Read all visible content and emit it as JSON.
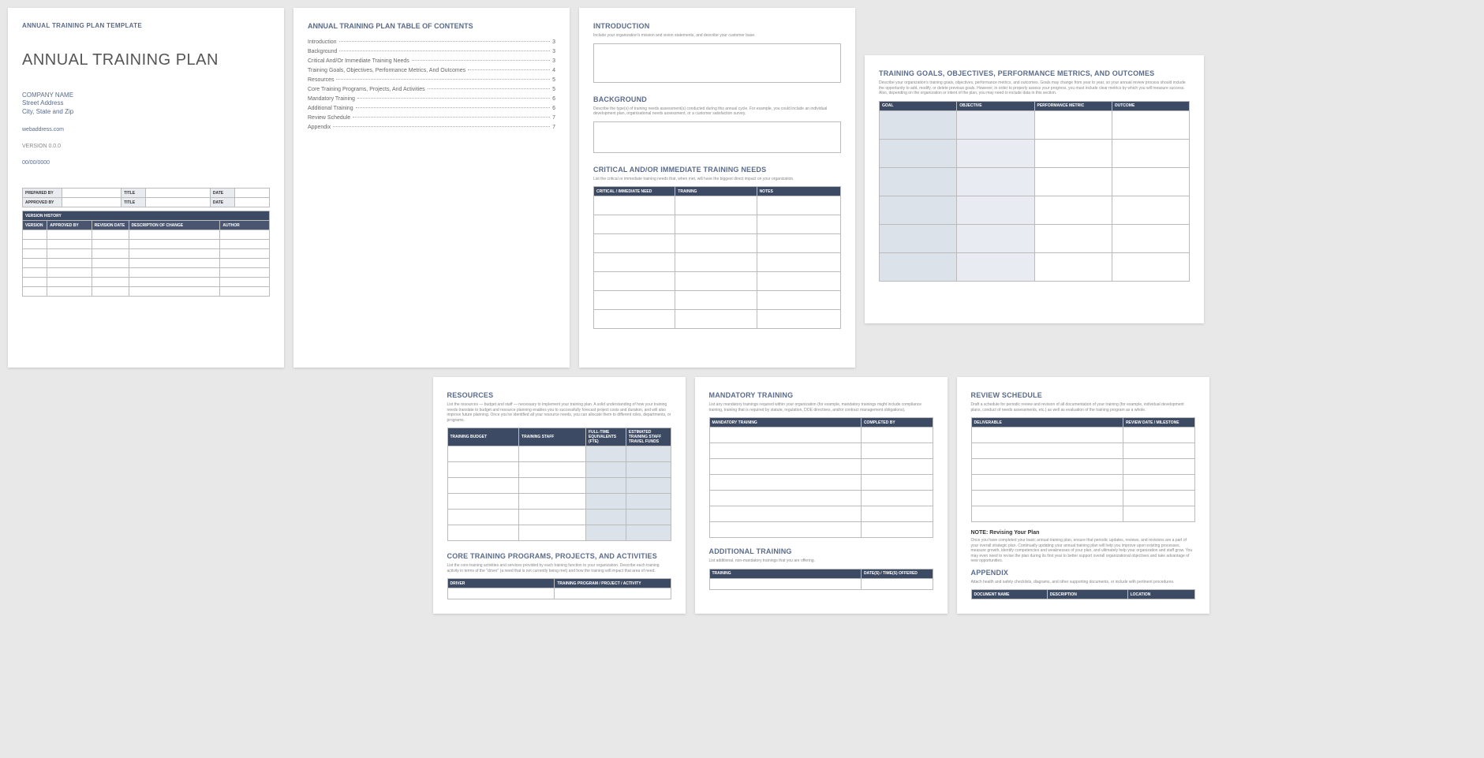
{
  "page1": {
    "header": "ANNUAL TRAINING PLAN TEMPLATE",
    "title": "ANNUAL TRAINING PLAN",
    "company": "COMPANY NAME",
    "street": "Street Address",
    "city": "City, State and Zip",
    "web": "webaddress.com",
    "version": "VERSION 0.0.0",
    "date": "00/00/0000",
    "prep_label": "PREPARED BY",
    "appr_label": "APPROVED BY",
    "title_label": "TITLE",
    "date_label": "DATE",
    "vh_header": "VERSION HISTORY",
    "vh_cols": {
      "c1": "VERSION",
      "c2": "APPROVED BY",
      "c3": "REVISION DATE",
      "c4": "DESCRIPTION OF CHANGE",
      "c5": "AUTHOR"
    }
  },
  "page2": {
    "title": "ANNUAL TRAINING PLAN TABLE OF CONTENTS",
    "items": [
      {
        "label": "Introduction",
        "pg": "3"
      },
      {
        "label": "Background",
        "pg": "3"
      },
      {
        "label": "Critical And/Or Immediate Training Needs",
        "pg": "3"
      },
      {
        "label": "Training Goals, Objectives, Performance Metrics, And Outcomes",
        "pg": "4"
      },
      {
        "label": "Resources",
        "pg": "5"
      },
      {
        "label": "Core Training Programs, Projects, And Activities",
        "pg": "5"
      },
      {
        "label": "Mandatory Training",
        "pg": "6"
      },
      {
        "label": "Additional Training",
        "pg": "6"
      },
      {
        "label": "Review Schedule",
        "pg": "7"
      },
      {
        "label": "Appendix",
        "pg": "7"
      }
    ]
  },
  "page3": {
    "intro_title": "INTRODUCTION",
    "intro_desc": "Include your organization's mission and vision statements, and describe your customer base.",
    "bg_title": "BACKGROUND",
    "bg_desc": "Describe the type(s) of training needs assessment(s) conducted during this annual cycle. For example, you could include an individual development plan, organizational needs assessment, or a customer satisfaction survey.",
    "crit_title": "CRITICAL AND/OR IMMEDIATE TRAINING NEEDS",
    "crit_desc": "List the critical or immediate training needs that, when met, will have the biggest direct impact on your organization.",
    "crit_cols": {
      "c1": "CRITICAL / IMMEDIATE NEED",
      "c2": "TRAINING",
      "c3": "NOTES"
    }
  },
  "page4": {
    "title": "TRAINING GOALS, OBJECTIVES, PERFORMANCE METRICS, AND OUTCOMES",
    "desc": "Describe your organization's training goals, objectives, performance metrics, and outcomes. Goals may change from year to year, so your annual review process should include the opportunity to add, modify, or delete previous goals. However, in order to properly assess your progress, you must include clear metrics by which you will measure success. Also, depending on the organization or intent of the plan, you may need to include data in this section.",
    "cols": {
      "c1": "GOAL",
      "c2": "OBJECTIVE",
      "c3": "PERFORMANCE METRIC",
      "c4": "OUTCOME"
    }
  },
  "page5": {
    "res_title": "RESOURCES",
    "res_desc": "List the resources — budget and staff — necessary to implement your training plan. A solid understanding of how your training needs translate to budget and resource planning enables you to successfully forecast project costs and duration, and will also improve future planning. Once you've identified all your resource needs, you can allocate them to different roles, departments, or programs.",
    "res_cols": {
      "c1": "TRAINING BUDGET",
      "c2": "TRAINING STAFF",
      "c3": "FULL-TIME EQUIVALENTS (FTE)",
      "c4": "ESTIMATED TRAINING STAFF TRAVEL FUNDS"
    },
    "core_title": "CORE TRAINING PROGRAMS, PROJECTS, AND ACTIVITIES",
    "core_desc": "List the core training activities and services provided by each training function to your organization. Describe each training activity in terms of the \"driver\" (a need that is not currently being met) and how the training will impact that area of need.",
    "core_cols": {
      "c1": "DRIVER",
      "c2": "TRAINING PROGRAM / PROJECT / ACTIVITY"
    }
  },
  "page6": {
    "mand_title": "MANDATORY TRAINING",
    "mand_desc": "List any mandatory trainings required within your organization (for example, mandatory trainings might include compliance training, training that is required by statute, regulation, DOE directives, and/or contract management obligations).",
    "mand_cols": {
      "c1": "MANDATORY TRAINING",
      "c2": "COMPLETED BY"
    },
    "add_title": "ADDITIONAL TRAINING",
    "add_desc": "List additional, non-mandatory trainings that you are offering.",
    "add_cols": {
      "c1": "TRAINING",
      "c2": "DATE(S) / TIME(S) OFFERED"
    }
  },
  "page7": {
    "rev_title": "REVIEW SCHEDULE",
    "rev_desc": "Draft a schedule for periodic review and revision of all documentation of your training (for example, individual development plans, conduct of needs assessments, etc.) as well as evaluation of the training program as a whole.",
    "rev_cols": {
      "c1": "DELIVERABLE",
      "c2": "REVIEW DATE / MILESTONE"
    },
    "note_title": "NOTE: Revising Your Plan",
    "note_body": "Once you have completed your basic annual training plan, ensure that periodic updates, reviews, and revisions are a part of your overall strategic plan. Continually updating your annual training plan will help you improve upon existing processes, measure growth, identify competencies and weaknesses of your plan, and ultimately help your organization and staff grow. You may even need to revise the plan during its first year to better support overall organizational objectives and take advantage of new opportunities.",
    "app_title": "APPENDIX",
    "app_desc": "Attach health and safety checklists, diagrams, and other supporting documents, or include with pertinent procedures.",
    "app_cols": {
      "c1": "DOCUMENT NAME",
      "c2": "DESCRIPTION",
      "c3": "LOCATION"
    }
  }
}
